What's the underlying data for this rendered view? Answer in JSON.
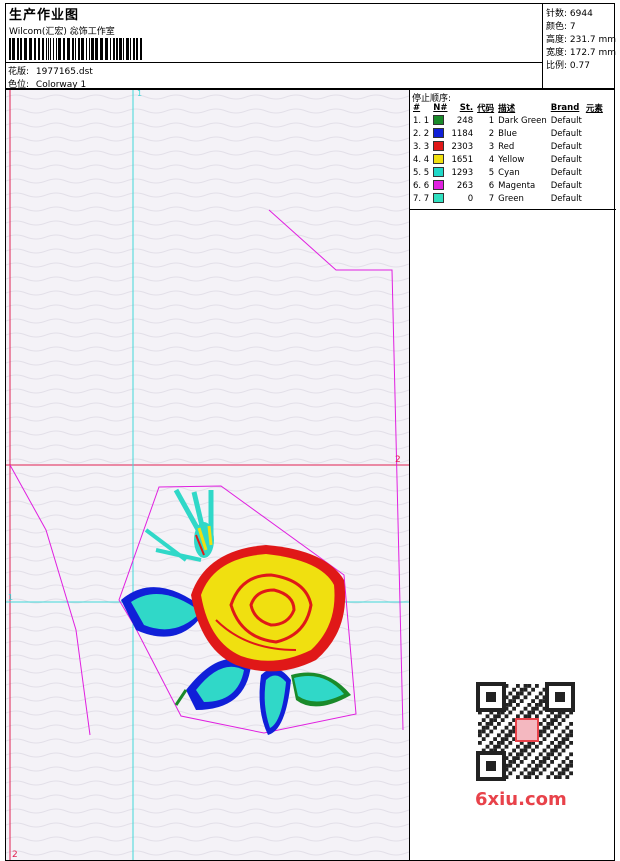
{
  "header": {
    "title": "生产作业图",
    "company": "Wilcom(汇宏) 惢饰工作室",
    "design_label": "花版:",
    "design_value": "1977165.dst",
    "colorway_label": "色位:",
    "colorway_value": "Colorway 1"
  },
  "stats": {
    "stitches": "针数: 6944",
    "colors": "颜色: 7",
    "height": "高度: 231.7 mm",
    "width": "宽度: 172.7 mm",
    "scale": "比例: 0.77"
  },
  "stop_sequence": {
    "label": "停止顺序:",
    "headers": [
      "#",
      "N#",
      "St.",
      "代码",
      "描述",
      "Brand",
      "元素"
    ],
    "rows": [
      {
        "idx": "1. 1",
        "color": "#1a8a2a",
        "st": "248",
        "code": "1",
        "desc": "Dark Green",
        "brand": "Default"
      },
      {
        "idx": "2. 2",
        "color": "#1020d8",
        "st": "1184",
        "code": "2",
        "desc": "Blue",
        "brand": "Default"
      },
      {
        "idx": "3. 3",
        "color": "#e01818",
        "st": "2303",
        "code": "3",
        "desc": "Red",
        "brand": "Default"
      },
      {
        "idx": "4. 4",
        "color": "#f0e010",
        "st": "1651",
        "code": "4",
        "desc": "Yellow",
        "brand": "Default"
      },
      {
        "idx": "5. 5",
        "color": "#20d8c8",
        "st": "1293",
        "code": "5",
        "desc": "Cyan",
        "brand": "Default"
      },
      {
        "idx": "6. 6",
        "color": "#e020e0",
        "st": "263",
        "code": "6",
        "desc": "Magenta",
        "brand": "Default"
      },
      {
        "idx": "7. 7",
        "color": "#30e0c0",
        "st": "0",
        "code": "7",
        "desc": "Green",
        "brand": "Default"
      }
    ]
  },
  "canvas_markers": {
    "top_1": "1",
    "right_2": "2",
    "left_1": "1",
    "bottom_2": "2"
  },
  "watermark": "6xiu.com",
  "colors": {
    "guide_cyan": "#40d8d8",
    "guide_red": "#e02050",
    "outline_magenta": "#e020e0"
  }
}
